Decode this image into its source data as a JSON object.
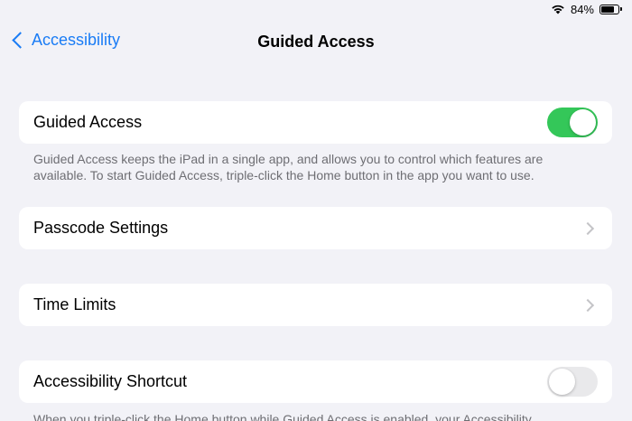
{
  "status_bar": {
    "battery_text": "84%",
    "battery_level": 0.84,
    "wifi_icon": "wifi-icon",
    "battery_icon": "battery-icon"
  },
  "nav": {
    "back_label": "Accessibility",
    "title": "Guided Access"
  },
  "guided_access": {
    "label": "Guided Access",
    "enabled": true,
    "footer": "Guided Access keeps the iPad in a single app, and allows you to control which features are available. To start Guided Access, triple-click the Home button in the app you want to use."
  },
  "passcode_settings": {
    "label": "Passcode Settings"
  },
  "time_limits": {
    "label": "Time Limits"
  },
  "accessibility_shortcut": {
    "label": "Accessibility Shortcut",
    "enabled": false,
    "footer": "When you triple-click the Home button while Guided Access is enabled, your Accessibility"
  },
  "colors": {
    "accent": "#1a7cf5",
    "toggle_on": "#34c759",
    "toggle_off": "#e9e9eb",
    "background": "#f2f2f7"
  }
}
